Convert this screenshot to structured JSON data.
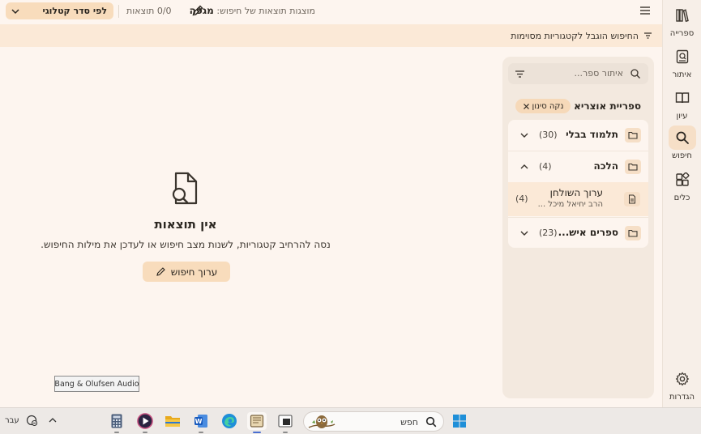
{
  "rail": {
    "items": [
      {
        "label": "ספרייה",
        "icon": "library-icon"
      },
      {
        "label": "איתור",
        "icon": "locate-icon"
      },
      {
        "label": "עיון",
        "icon": "book-open-icon"
      },
      {
        "label": "חיפוש",
        "icon": "search-icon",
        "active": true
      },
      {
        "label": "כלים",
        "icon": "tools-icon"
      }
    ],
    "settings_label": "הגדרות"
  },
  "toolbar": {
    "sort_label": "לפי סדר קטלוגי",
    "results_count": "0/0 תוצאות",
    "query_prefix": "מוצגות תוצאות של חיפוש:",
    "query_term": "מגפה"
  },
  "banner": {
    "text": "החיפוש הוגבל לקטגוריות מסוימות"
  },
  "sidebar": {
    "search_placeholder": "איתור ספר...",
    "library_label": "ספריית אוצריא",
    "clear_filter_label": "נקה סינון",
    "tree": [
      {
        "title": "תלמוד בבלי",
        "count": "(30)",
        "expanded": false
      },
      {
        "title": "הלכה",
        "count": "(4)",
        "expanded": true
      },
      {
        "title": "ערוך השולחן",
        "subtitle": "הרב יחיאל מיכל ...",
        "count": "(4)",
        "child": true
      },
      {
        "title": "ספרים איש...",
        "count": "(23)",
        "expanded": false
      }
    ]
  },
  "empty_state": {
    "title": "אין תוצאות",
    "subtitle": "נסה להרחיב קטגוריות, לשנות מצב חיפוש או לעדכן את מילות החיפוש.",
    "edit_button": "ערוך חיפוש"
  },
  "tooltip": {
    "text": "Bang & Olufsen Audio"
  },
  "taskbar": {
    "search_text": "חפש",
    "language": "עבר",
    "apps": [
      "calculator-icon",
      "media-player-icon",
      "file-explorer-icon",
      "word-icon",
      "edge-icon",
      "otzaria-icon",
      "terminal-icon"
    ]
  },
  "colors": {
    "accent": "#f8dcbc",
    "banner": "#fbe9d7",
    "background": "#fdf5ef"
  }
}
